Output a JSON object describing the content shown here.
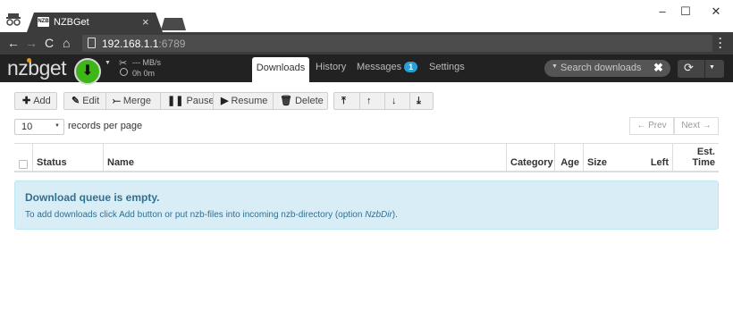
{
  "browser": {
    "tab_title": "NZBGet",
    "favicon_text": "NZB",
    "url_host": "192.168.1.1",
    "url_port": ":6789"
  },
  "app": {
    "logo": "nzbget",
    "speed": "--- MB/s",
    "remaining_time": "0h 0m",
    "tabs": [
      {
        "label": "Downloads",
        "active": true
      },
      {
        "label": "History",
        "active": false
      },
      {
        "label": "Messages",
        "active": false,
        "badge": "1"
      },
      {
        "label": "Settings",
        "active": false
      }
    ],
    "search_placeholder": "Search downloads"
  },
  "toolbar": {
    "add": "Add",
    "edit": "Edit",
    "merge": "Merge",
    "pause": "Pause",
    "resume": "Resume",
    "delete": "Delete",
    "move_icons": [
      "move-top-icon",
      "move-up-icon",
      "move-down-icon",
      "move-bottom-icon"
    ]
  },
  "paging": {
    "records_value": "10",
    "records_label": "records per page",
    "prev": "← Prev",
    "next": "Next →"
  },
  "table": {
    "columns": [
      "Status",
      "Name",
      "Category",
      "Age",
      "Size",
      "Left",
      "Est. Time"
    ]
  },
  "alert": {
    "title": "Download queue is empty.",
    "text_before": "To add downloads click Add button or put nzb-files into incoming nzb-directory (option ",
    "option": "NzbDir",
    "text_after": ")."
  },
  "colors": {
    "navbar": "#222222",
    "play_button": "#3fb618",
    "badge": "#2a9fd6",
    "alert_bg": "#d9edf7",
    "alert_text": "#31708f"
  }
}
